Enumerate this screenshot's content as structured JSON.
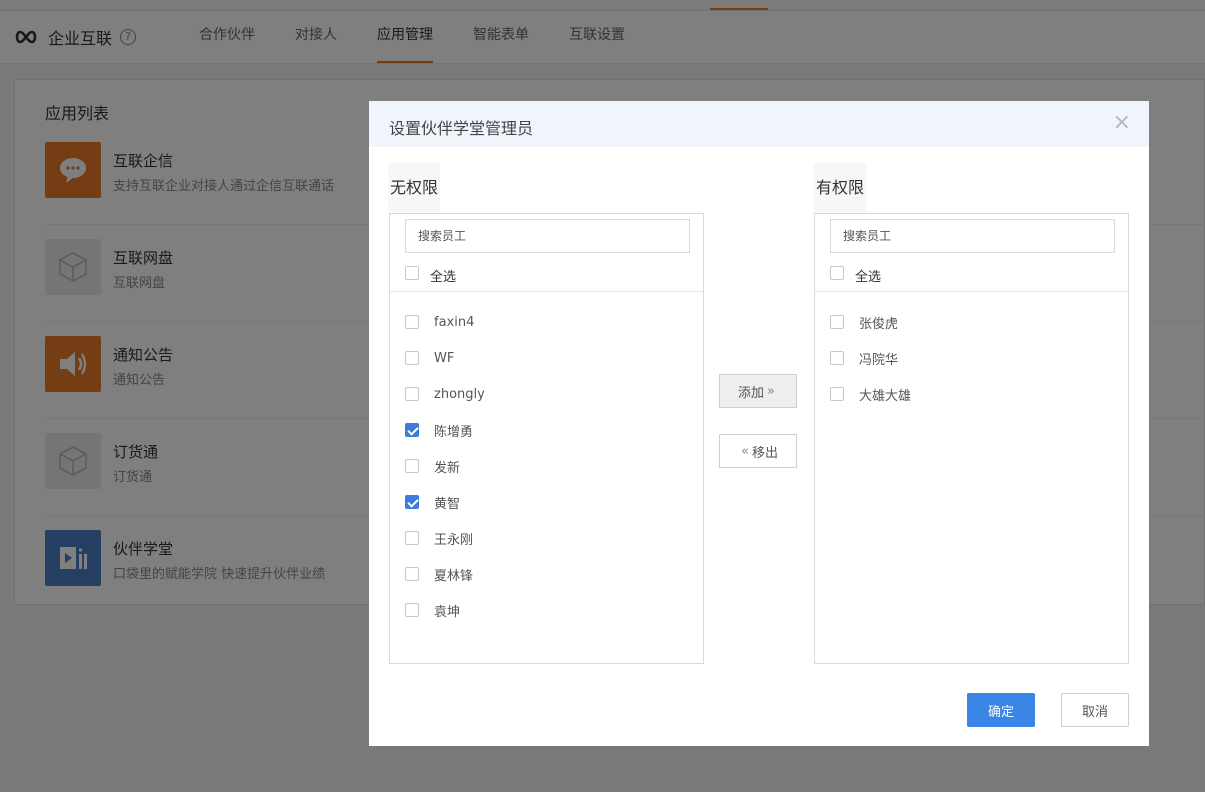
{
  "header": {
    "brand_title": "企业互联",
    "help_glyph": "?",
    "tabs": [
      {
        "label": "合作伙伴",
        "active": false
      },
      {
        "label": "对接人",
        "active": false
      },
      {
        "label": "应用管理",
        "active": true
      },
      {
        "label": "智能表单",
        "active": false
      },
      {
        "label": "互联设置",
        "active": false
      }
    ]
  },
  "panel": {
    "title": "应用列表",
    "apps": [
      {
        "name": "互联企信",
        "desc": "支持互联企业对接人通过企信互联通话",
        "icon": "chat-bubble-icon",
        "color": "#e87b27"
      },
      {
        "name": "互联网盘",
        "desc": "互联网盘",
        "icon": "cube-icon",
        "color": "#eaeaea"
      },
      {
        "name": "通知公告",
        "desc": "通知公告",
        "icon": "speaker-icon",
        "color": "#e87b27"
      },
      {
        "name": "订货通",
        "desc": "订货通",
        "icon": "cube-icon",
        "color": "#eaeaea"
      },
      {
        "name": "伙伴学堂",
        "desc": "口袋里的赋能学院  快速提升伙伴业绩",
        "icon": "video-book-icon",
        "color": "#4a7ec6"
      }
    ]
  },
  "dialog": {
    "title": "设置伙伴学堂管理员",
    "close_glyph": "×",
    "left": {
      "title": "无权限",
      "search_placeholder": "搜索员工",
      "select_all": "全选",
      "items": [
        {
          "label": "faxin4",
          "checked": false
        },
        {
          "label": "WF",
          "checked": false
        },
        {
          "label": "zhongly",
          "checked": false
        },
        {
          "label": "陈增勇",
          "checked": true
        },
        {
          "label": "发新",
          "checked": false
        },
        {
          "label": "黄智",
          "checked": true
        },
        {
          "label": "王永刚",
          "checked": false
        },
        {
          "label": "夏林锋",
          "checked": false
        },
        {
          "label": "袁坤",
          "checked": false
        }
      ]
    },
    "right": {
      "title": "有权限",
      "search_placeholder": "搜索员工",
      "select_all": "全选",
      "items": [
        {
          "label": "张俊虎",
          "checked": false
        },
        {
          "label": "冯院华",
          "checked": false
        },
        {
          "label": "大雄大雄",
          "checked": false
        }
      ]
    },
    "add_label": "添加",
    "add_arrow": "»",
    "remove_label": "移出",
    "remove_arrow": "«",
    "ok_label": "确定",
    "cancel_label": "取消"
  },
  "colors": {
    "accent": "#e87b27",
    "primary": "#3a86e6",
    "checkbox_checked": "#3a7ddb"
  }
}
